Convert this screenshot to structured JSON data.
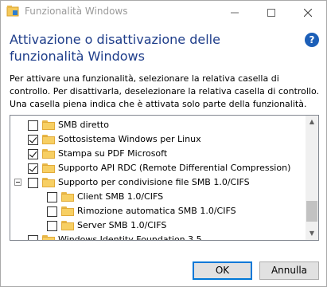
{
  "window": {
    "title": "Funzionalità Windows",
    "controls": {
      "minimize": "—",
      "maximize": "☐",
      "close": "✕"
    }
  },
  "heading": "Attivazione o disattivazione delle funzionalità Windows",
  "help_icon": "?",
  "description": "Per attivare una funzionalità, selezionare la relativa casella di controllo. Per disattivarla, deselezionare la relativa casella di controllo. Una casella piena indica che è attivata solo parte della funzionalità.",
  "features": [
    {
      "label": "SMB diretto",
      "checked": false,
      "level": 0
    },
    {
      "label": "Sottosistema Windows per Linux",
      "checked": true,
      "level": 0
    },
    {
      "label": "Stampa su PDF Microsoft",
      "checked": true,
      "level": 0
    },
    {
      "label": "Supporto API RDC (Remote Differential Compression)",
      "checked": true,
      "level": 0
    },
    {
      "label": "Supporto per condivisione file SMB 1.0/CIFS",
      "checked": false,
      "level": 0,
      "expanded": true
    },
    {
      "label": "Client SMB 1.0/CIFS",
      "checked": false,
      "level": 1
    },
    {
      "label": "Rimozione automatica SMB 1.0/CIFS",
      "checked": false,
      "level": 1
    },
    {
      "label": "Server SMB 1.0/CIFS",
      "checked": false,
      "level": 1
    },
    {
      "label": "Windows Identity Foundation 3.5",
      "checked": false,
      "level": 0
    }
  ],
  "buttons": {
    "ok": "OK",
    "cancel": "Annulla"
  }
}
